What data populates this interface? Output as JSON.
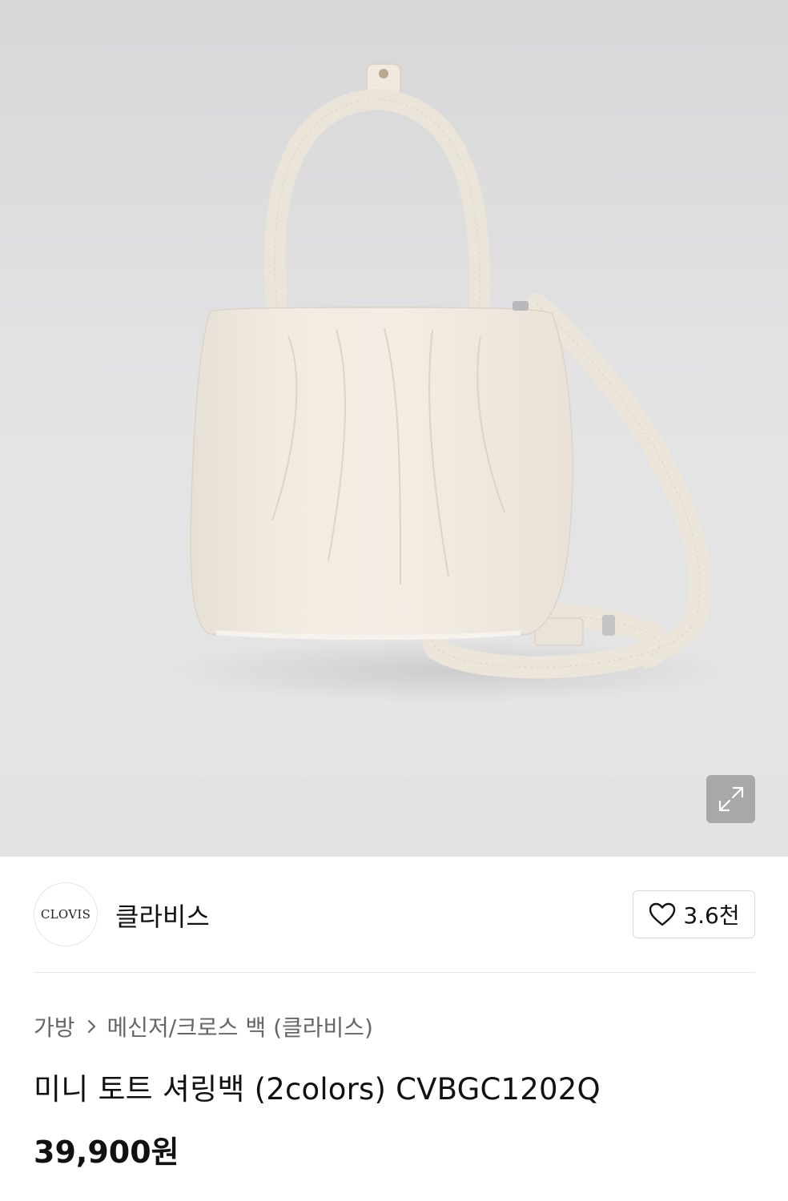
{
  "product_image": {
    "alt": "",
    "icon": "product-photo"
  },
  "expand": {
    "icon": "expand-arrows-icon"
  },
  "brand": {
    "logo_text": "CLOVIS",
    "name": "클라비스"
  },
  "like": {
    "icon": "heart-icon",
    "count": "3.6천"
  },
  "breadcrumb": {
    "items": [
      "가방",
      "메신저/크로스 백 (클라비스)"
    ],
    "separator_icon": "chevron-right-icon"
  },
  "product": {
    "title": "미니 토트 셔링백 (2colors) CVBGC1202Q",
    "price": "39,900원"
  },
  "colors": {
    "background": "#ffffff",
    "hero_bg": "#e3e3e4",
    "bag": "#efe8dd",
    "text": "#111111",
    "muted": "#666666"
  }
}
